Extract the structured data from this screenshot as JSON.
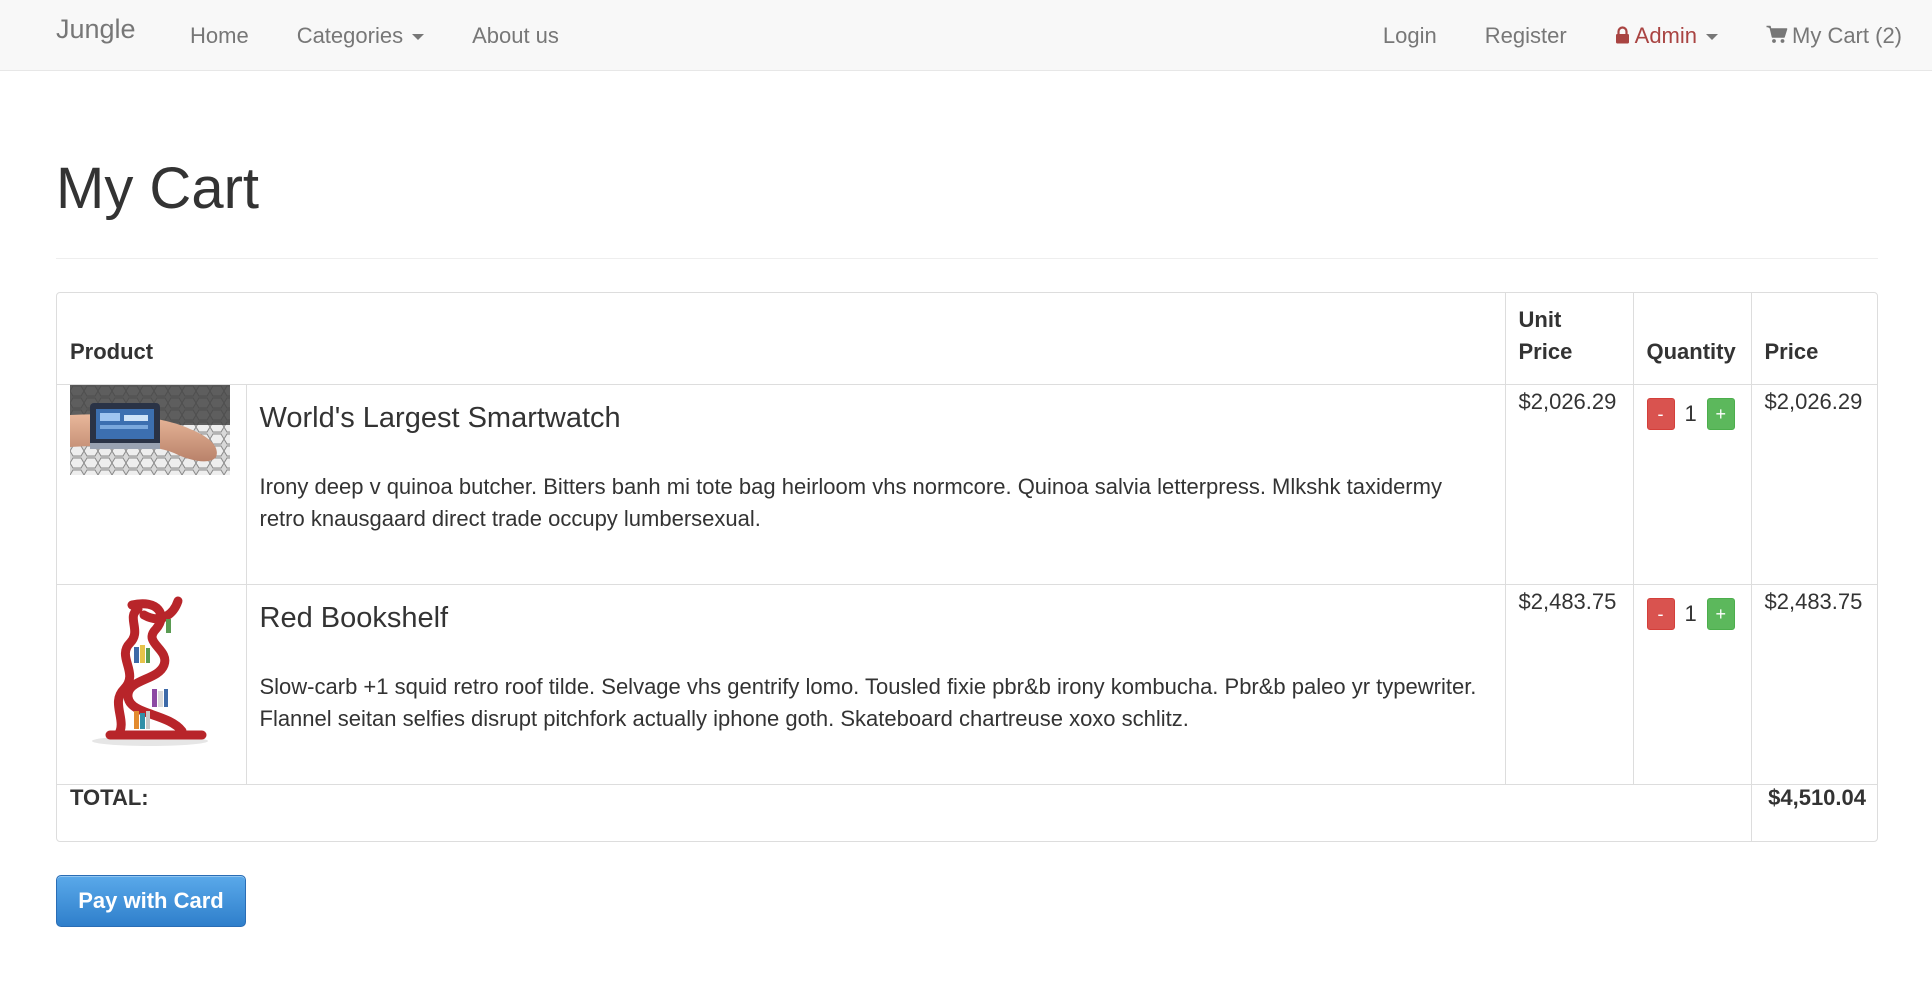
{
  "navbar": {
    "brand": "Jungle",
    "left_links": {
      "home": "Home",
      "categories": "Categories",
      "about": "About us"
    },
    "right_links": {
      "login": "Login",
      "register": "Register",
      "admin": "Admin",
      "cart": "My Cart (2)"
    },
    "admin_color": "#a94442"
  },
  "page": {
    "title": "My Cart"
  },
  "table": {
    "headers": {
      "product": "Product",
      "unit_price": "Unit Price",
      "quantity": "Quantity",
      "price": "Price"
    },
    "items": [
      {
        "image": "smartwatch-photo",
        "name": "World's Largest Smartwatch",
        "description": "Irony deep v quinoa butcher. Bitters banh mi tote bag heirloom vhs normcore. Quinoa salvia letterpress. Mlkshk taxidermy retro knausgaard direct trade occupy lumbersexual.",
        "unit_price": "$2,026.29",
        "quantity": "1",
        "price": "$2,026.29",
        "minus_label": "-",
        "plus_label": "+"
      },
      {
        "image": "red-bookshelf-photo",
        "name": "Red Bookshelf",
        "description": "Slow-carb +1 squid retro roof tilde. Selvage vhs gentrify lomo. Tousled fixie pbr&b irony kombucha. Pbr&b paleo yr typewriter. Flannel seitan selfies disrupt pitchfork actually iphone goth. Skateboard chartreuse xoxo schlitz.",
        "unit_price": "$2,483.75",
        "quantity": "1",
        "price": "$2,483.75",
        "minus_label": "-",
        "plus_label": "+"
      }
    ],
    "total_label": "TOTAL:",
    "total_value": "$4,510.04"
  },
  "actions": {
    "pay_label": "Pay with Card",
    "pay_color": "#337ab7"
  },
  "colors": {
    "minus_button": "#d9534f",
    "plus_button": "#5cb85c"
  },
  "icons": {
    "admin": "lock-icon",
    "cart": "shopping-cart-icon",
    "dropdown": "caret-down-icon"
  }
}
